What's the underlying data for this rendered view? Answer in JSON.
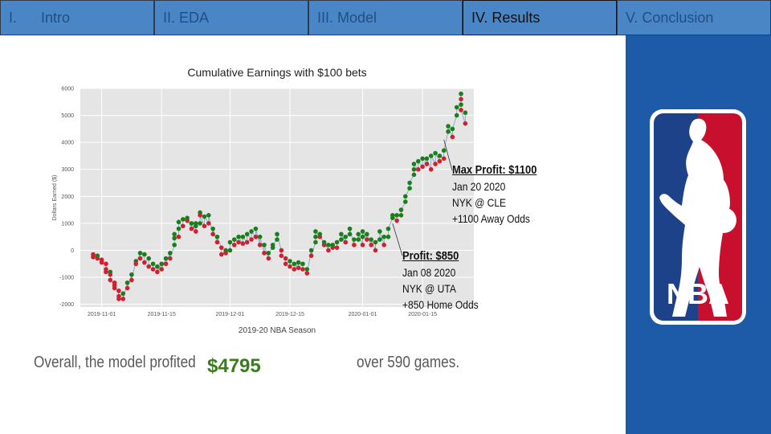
{
  "nav": {
    "tabs": [
      {
        "num": "I.",
        "label": "Intro"
      },
      {
        "num": "",
        "label": "II. EDA"
      },
      {
        "num": "",
        "label": "III. Model"
      },
      {
        "num": "",
        "label": "IV. Results"
      },
      {
        "num": "",
        "label": "V. Conclusion"
      }
    ],
    "active_index": 3
  },
  "logo": {
    "text": "NBA",
    "colors": {
      "blue": "#1d428a",
      "red": "#c8102e",
      "white": "#ffffff"
    }
  },
  "annotations": {
    "max_profit": {
      "heading": "Max Profit: $1100",
      "date": "Jan 20 2020",
      "matchup": "NYK @ CLE",
      "odds": "+1100 Away Odds"
    },
    "profit_850": {
      "heading": "Profit: $850",
      "date": "Jan 08 2020",
      "matchup": "NYK @ UTA",
      "odds": "+850 Home Odds"
    }
  },
  "summary": {
    "prefix": "Overall, the model profited",
    "value": "$4795",
    "suffix": "over 590 games."
  },
  "chart_data": {
    "type": "scatter",
    "title": "Cumulative Earnings with $100 bets",
    "xlabel": "2019-20 NBA Season",
    "ylabel": "Dollars Earned ($)",
    "ylim": [
      -2100,
      6000
    ],
    "yticks": [
      -2000,
      -1000,
      0,
      1000,
      2000,
      3000,
      4000,
      5000,
      6000
    ],
    "xticks": [
      "2019-11-01",
      "2019-11-15",
      "2019-12-01",
      "2019-12-15",
      "2020-01-01",
      "2020-01-15"
    ],
    "xlim": [
      "2019-10-27",
      "2020-01-27"
    ],
    "grid": true,
    "colors": {
      "win": "#1a7f1a",
      "loss": "#d0202f",
      "line": "#7a9cc4",
      "plot_bg": "#e5e5e5"
    },
    "x": [
      "2019-10-30",
      "2019-10-31",
      "2019-11-01",
      "2019-11-02",
      "2019-11-03",
      "2019-11-04",
      "2019-11-05",
      "2019-11-06",
      "2019-11-07",
      "2019-11-08",
      "2019-11-09",
      "2019-11-10",
      "2019-11-11",
      "2019-11-12",
      "2019-11-13",
      "2019-11-14",
      "2019-11-15",
      "2019-11-16",
      "2019-11-17",
      "2019-11-18",
      "2019-11-19",
      "2019-11-20",
      "2019-11-21",
      "2019-11-22",
      "2019-11-23",
      "2019-11-24",
      "2019-11-25",
      "2019-11-26",
      "2019-11-27",
      "2019-11-28",
      "2019-11-29",
      "2019-11-30",
      "2019-12-01",
      "2019-12-02",
      "2019-12-03",
      "2019-12-04",
      "2019-12-05",
      "2019-12-06",
      "2019-12-07",
      "2019-12-08",
      "2019-12-09",
      "2019-12-10",
      "2019-12-11",
      "2019-12-12",
      "2019-12-13",
      "2019-12-14",
      "2019-12-15",
      "2019-12-16",
      "2019-12-17",
      "2019-12-18",
      "2019-12-19",
      "2019-12-20",
      "2019-12-21",
      "2019-12-22",
      "2019-12-23",
      "2019-12-24",
      "2019-12-25",
      "2019-12-26",
      "2019-12-27",
      "2019-12-28",
      "2019-12-29",
      "2019-12-30",
      "2019-12-31",
      "2020-01-01",
      "2020-01-02",
      "2020-01-03",
      "2020-01-04",
      "2020-01-05",
      "2020-01-06",
      "2020-01-07",
      "2020-01-08",
      "2020-01-09",
      "2020-01-10",
      "2020-01-11",
      "2020-01-12",
      "2020-01-13",
      "2020-01-14",
      "2020-01-15",
      "2020-01-16",
      "2020-01-17",
      "2020-01-18",
      "2020-01-19",
      "2020-01-20",
      "2020-01-21",
      "2020-01-22",
      "2020-01-23",
      "2020-01-24",
      "2020-01-25"
    ],
    "series": [
      {
        "values": [
          [
            -150,
            -250
          ],
          [
            -200,
            -300
          ],
          [
            -350,
            -450
          ],
          [
            -500,
            -700,
            -800
          ],
          [
            -800,
            -900,
            -1100
          ],
          [
            -1200,
            -1300,
            -1400
          ],
          [
            -1500,
            -1700,
            -1800
          ],
          [
            -1600,
            -1800
          ],
          [
            -1200,
            -1400
          ],
          [
            -900,
            -1100
          ],
          [
            -400,
            -500
          ],
          [
            -100,
            -300
          ],
          [
            -150,
            -450
          ],
          [
            -300,
            -600
          ],
          [
            -500,
            -700
          ],
          [
            -600,
            -800
          ],
          [
            -500,
            -700
          ],
          [
            -300,
            -500
          ],
          [
            -100,
            -300
          ],
          [
            200,
            450,
            600
          ],
          [
            500,
            800,
            1050
          ],
          [
            900,
            1150
          ],
          [
            1100,
            1200
          ],
          [
            800,
            1000
          ],
          [
            700,
            900,
            1000
          ],
          [
            1000,
            1400,
            1300
          ],
          [
            900,
            1250
          ],
          [
            1000,
            1300
          ],
          [
            600,
            800
          ],
          [
            300,
            500
          ],
          [
            100,
            -150
          ],
          [
            0,
            -100
          ],
          [
            0,
            300
          ],
          [
            200,
            400
          ],
          [
            300,
            500
          ],
          [
            250,
            500
          ],
          [
            300,
            600
          ],
          [
            400,
            700
          ],
          [
            500,
            800
          ],
          [
            200,
            500
          ],
          [
            -100,
            200
          ],
          [
            -300,
            -100
          ],
          [
            100,
            200
          ],
          [
            400,
            600
          ],
          [
            0,
            -200
          ],
          [
            -300,
            -500
          ],
          [
            -400,
            -600
          ],
          [
            -500,
            -700
          ],
          [
            -450,
            -650
          ],
          [
            -500,
            -700
          ],
          [
            -700,
            -850
          ],
          [
            0,
            -200
          ],
          [
            300,
            500,
            700
          ],
          [
            500,
            600
          ],
          [
            200,
            300
          ],
          [
            0,
            200
          ],
          [
            100,
            200
          ],
          [
            100,
            300
          ],
          [
            400,
            600
          ],
          [
            300,
            500
          ],
          [
            600,
            800
          ],
          [
            200,
            400
          ],
          [
            400,
            600
          ],
          [
            200,
            500,
            700
          ],
          [
            400,
            600
          ],
          [
            200,
            400
          ],
          [
            0,
            300
          ],
          [
            400,
            700
          ],
          [
            200,
            500
          ],
          [
            500,
            800
          ],
          [
            1200,
            1300
          ],
          [
            1100,
            1300
          ],
          [
            1300,
            1500
          ],
          [
            1800,
            2000
          ],
          [
            2300,
            2500
          ],
          [
            2800,
            3000,
            3200
          ],
          [
            3000,
            3300
          ],
          [
            3100,
            3400
          ],
          [
            3200,
            3400
          ],
          [
            3000,
            3500
          ],
          [
            3200,
            3600
          ],
          [
            3300,
            3500
          ],
          [
            3400,
            3700
          ],
          [
            4400,
            4600
          ],
          [
            4200,
            4500
          ],
          [
            5000,
            5300
          ],
          [
            5400,
            5800,
            5600,
            5200
          ],
          [
            4700,
            5100
          ]
        ]
      }
    ]
  }
}
